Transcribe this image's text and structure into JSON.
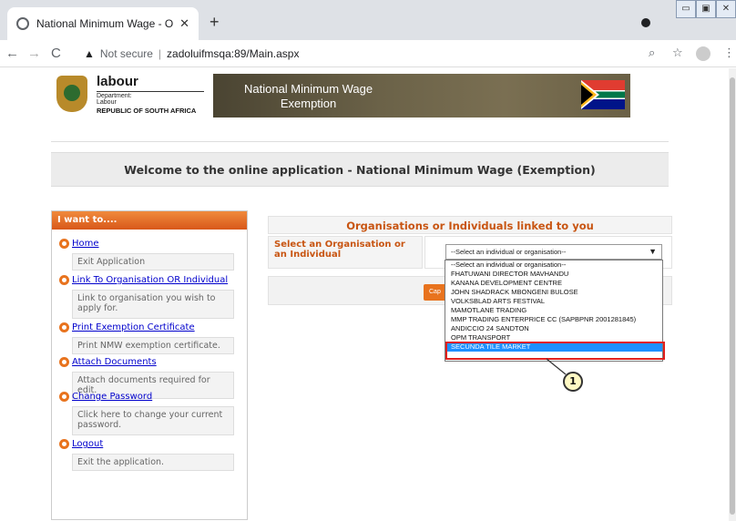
{
  "browser": {
    "tab_title": "National Minimum Wage - Onlin",
    "tab_close": "✕",
    "new_tab": "+",
    "security_text": "Not secure",
    "url": "zadoluifmsqa:89/Main.aspx",
    "icons": [
      "globe-icon",
      "back-icon",
      "forward-icon",
      "reload-icon",
      "warning-icon",
      "zoom-icon",
      "star-icon",
      "account-icon",
      "more-icon"
    ]
  },
  "logo": {
    "name": "labour",
    "department": [
      "Department:",
      "Labour"
    ],
    "country": "REPUBLIC OF SOUTH AFRICA"
  },
  "banner": {
    "line1": "National Minimum Wage",
    "line2": "Exemption"
  },
  "welcome": "Welcome to the online application - National Minimum Wage (Exemption)",
  "menu": {
    "header": "I want to....",
    "items": [
      {
        "label": "Home",
        "desc": "Exit Application"
      },
      {
        "label": "Link To Organisation OR Individual",
        "desc": "Link to organisation you wish to apply for."
      },
      {
        "label": "Print Exemption Certificate",
        "desc": "Print NMW exemption certificate."
      },
      {
        "label": "Attach Documents",
        "desc": "Attach documents required for edit."
      },
      {
        "label": "Change Password",
        "desc": "Click here to change your current password."
      },
      {
        "label": "Logout",
        "desc": "Exit the application."
      }
    ]
  },
  "panel": {
    "title": "Organisations or Individuals linked to you",
    "select_label": "Select an Organisation or an Individual",
    "select_value": "--Select an individual or organisation--",
    "button_label": "Cap"
  },
  "dropdown": {
    "options": [
      "--Select an individual or organisation--",
      "FHATUWANI DIRECTOR MAVHANDU",
      "KANANA DEVELOPMENT CENTRE",
      "JOHN SHADRACK MBONGENI BULOSE",
      "VOLKSBLAD ARTS FESTIVAL",
      "MAMOTLANE TRADING",
      "MMP TRADING ENTERPRICE CC (SAPBPNR 2001281845)",
      "ANDICCIO 24 SANDTON",
      "OPM TRANSPORT",
      "SECUNDA TILE MARKET"
    ],
    "selected_index": 9
  },
  "annotation": {
    "label": "1",
    "color": "#e0201e"
  }
}
